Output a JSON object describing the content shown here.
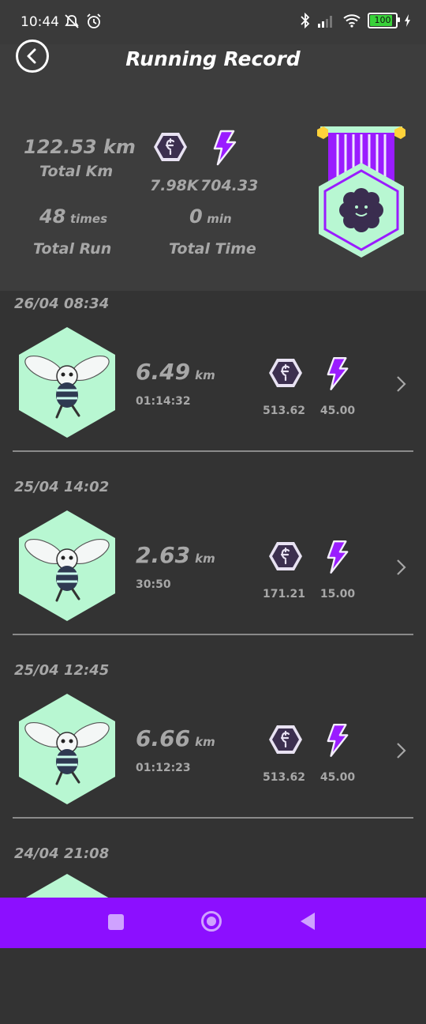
{
  "status": {
    "time": "10:44",
    "battery": "100"
  },
  "header": {
    "title": "Running Record",
    "total_km_value": "122.53 km",
    "total_km_label": "Total Km",
    "coin_total": "7.98K",
    "energy_total": "704.33",
    "runs_value": "48",
    "runs_unit": "times",
    "runs_label": "Total Run",
    "time_value": "0",
    "time_unit": "min",
    "time_label": "Total Time"
  },
  "entries": [
    {
      "date": "26/04 08:34",
      "km": "6.49",
      "km_unit": "km",
      "duration": "01:14:32",
      "coin": "513.62",
      "energy": "45.00"
    },
    {
      "date": "25/04 14:02",
      "km": "2.63",
      "km_unit": "km",
      "duration": "30:50",
      "coin": "171.21",
      "energy": "15.00"
    },
    {
      "date": "25/04 12:45",
      "km": "6.66",
      "km_unit": "km",
      "duration": "01:12:23",
      "coin": "513.62",
      "energy": "45.00"
    },
    {
      "date": "24/04 21:08"
    }
  ],
  "icons": {
    "back": "back-circle-icon",
    "coin": "hex-coin-icon",
    "energy": "lightning-bolt-icon",
    "medal": "flower-medal-icon",
    "chevron": "chevron-right-icon"
  },
  "colors": {
    "accent": "#8c0fff",
    "mint": "#b8f7d2",
    "coin_dark": "#3c2f4f"
  }
}
